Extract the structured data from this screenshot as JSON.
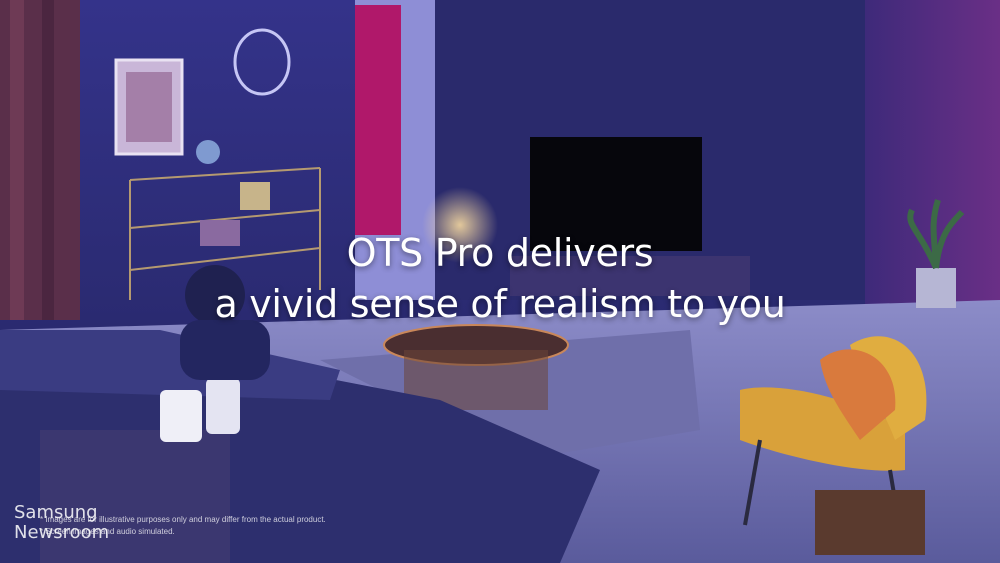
{
  "caption": {
    "line1": "OTS Pro delivers",
    "line2": "a vivid sense of realism to you"
  },
  "disclaimer": {
    "line1": "* Images are for illustrative purposes only and may differ from the actual product.",
    "line2": "* Screen images and audio simulated."
  },
  "brand": {
    "line1": "Samsung",
    "line2": "Newsroom"
  },
  "colors": {
    "wall": "#2f2f7a",
    "wall_dark": "#23235c",
    "floor": "#6a6bb0",
    "sofa": "#2d2f6e",
    "chair": "#d9a13a",
    "cushion": "#d97a3d",
    "door": "#b0186a",
    "tv": "#06060c"
  }
}
